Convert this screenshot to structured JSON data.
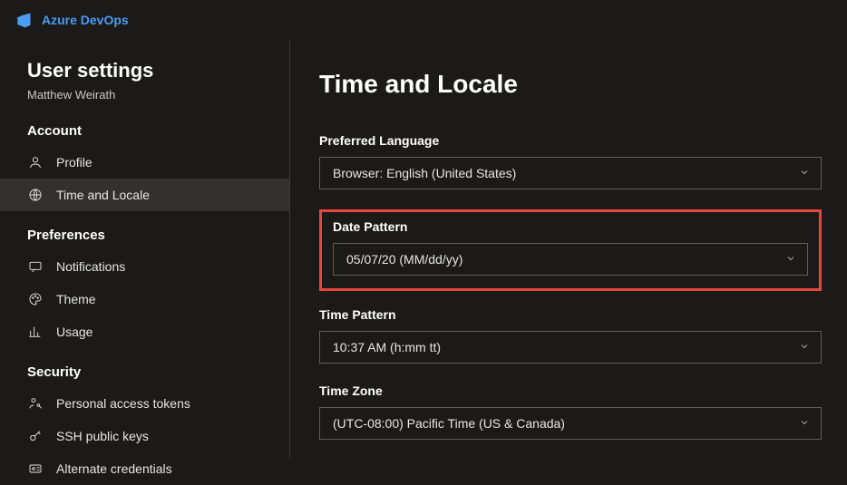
{
  "brand": {
    "name": "Azure DevOps"
  },
  "sidebar": {
    "title": "User settings",
    "username": "Matthew Weirath",
    "sections": [
      {
        "label": "Account",
        "items": [
          {
            "label": "Profile"
          },
          {
            "label": "Time and Locale"
          }
        ]
      },
      {
        "label": "Preferences",
        "items": [
          {
            "label": "Notifications"
          },
          {
            "label": "Theme"
          },
          {
            "label": "Usage"
          }
        ]
      },
      {
        "label": "Security",
        "items": [
          {
            "label": "Personal access tokens"
          },
          {
            "label": "SSH public keys"
          },
          {
            "label": "Alternate credentials"
          }
        ]
      }
    ]
  },
  "main": {
    "title": "Time and Locale",
    "fields": {
      "language": {
        "label": "Preferred Language",
        "value": "Browser: English (United States)"
      },
      "date": {
        "label": "Date Pattern",
        "value": "05/07/20 (MM/dd/yy)"
      },
      "time": {
        "label": "Time Pattern",
        "value": "10:37 AM (h:mm tt)"
      },
      "tz": {
        "label": "Time Zone",
        "value": "(UTC-08:00) Pacific Time (US & Canada)"
      }
    }
  },
  "colors": {
    "highlight": "#e8463a",
    "accent": "#4a9cf2"
  }
}
